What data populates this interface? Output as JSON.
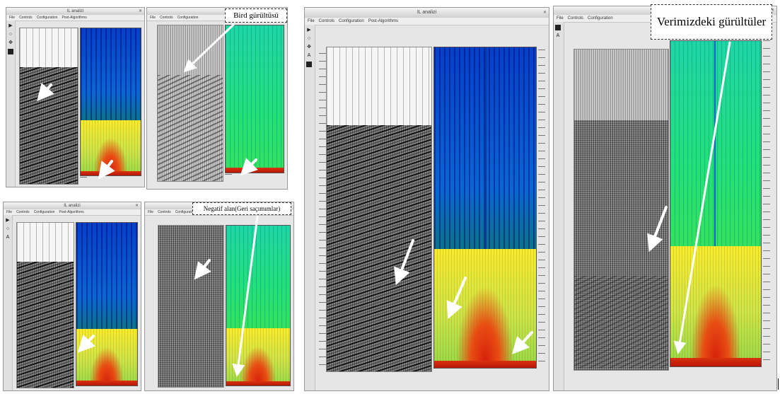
{
  "callouts": {
    "bird": "Bird gürültüsü",
    "negative": "Negatif alan(Geri saçımımlar)",
    "ours": "Verimizdeki gürültüler"
  },
  "windows": {
    "analysis_title": "IL analizi",
    "menu": [
      "File",
      "Controls",
      "Configuration",
      "Post-Algorithms"
    ],
    "colors": {
      "spectrum_blue": "#2b8fe6",
      "spectrum_green": "#22e07a",
      "spectrum_yellow": "#f3ee2e",
      "spectrum_red": "#d6200c"
    }
  },
  "icons": [
    "play-icon",
    "zoom-icon",
    "pan-icon",
    "amplitude-icon",
    "palette-icon"
  ]
}
